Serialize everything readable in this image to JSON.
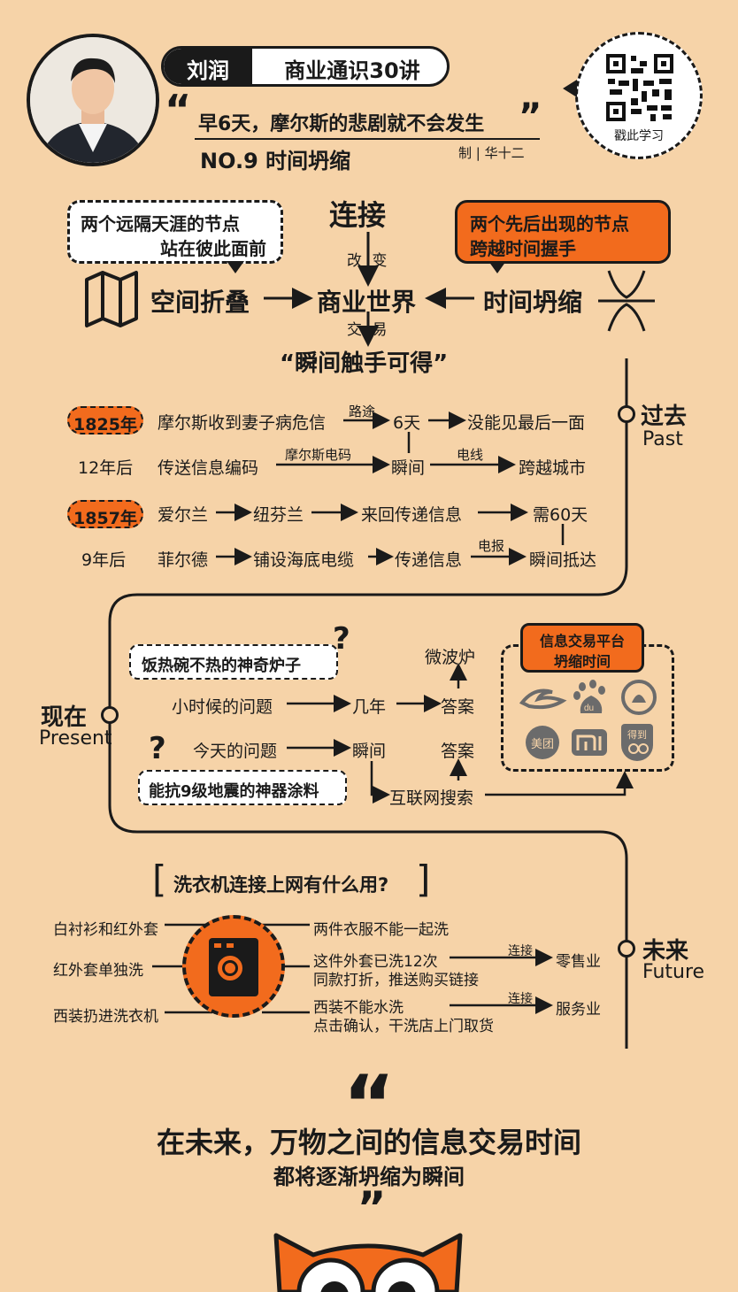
{
  "colors": {
    "background": "#f6d3a8",
    "accent": "#f26b1d",
    "ink": "#1a1a1a"
  },
  "header": {
    "author": "刘润",
    "course": "商业通识30讲",
    "quote": "早6天，摩尔斯的悲剧就不会发生",
    "episode": "NO.9 时间坍缩",
    "credit": "制 | 华十二",
    "qr_label": "戳此学习",
    "portrait_icon": "author-portrait",
    "qr_icon": "qr-code"
  },
  "concept": {
    "bubble_left": [
      "两个远隔天涯的节点",
      "站在彼此面前"
    ],
    "bubble_right": [
      "两个先后出现的节点",
      "跨越时间握手"
    ],
    "top": "连接",
    "change": "改 变",
    "left": "空间折叠",
    "center": "商业世界",
    "right": "时间坍缩",
    "trade": "交 易",
    "bottom": "“瞬间触手可得”",
    "map_icon": "folded-map-icon",
    "converge_icon": "converging-lines-icon"
  },
  "past": {
    "title": "过去",
    "title_en": "Past",
    "row1": {
      "year": "1825年",
      "event": "摩尔斯收到妻子病危信",
      "via": "路途",
      "time": "6天",
      "result": "没能见最后一面"
    },
    "row2": {
      "year": "12年后",
      "event": "传送信息编码",
      "via": "摩尔斯电码",
      "time": "瞬间",
      "via2": "电线",
      "result": "跨越城市"
    },
    "row3": {
      "year": "1857年",
      "from": "爱尔兰",
      "to": "纽芬兰",
      "action": "来回传递信息",
      "result": "需60天"
    },
    "row4": {
      "year": "9年后",
      "who": "菲尔德",
      "action": "铺设海底电缆",
      "what": "传递信息",
      "via": "电报",
      "result": "瞬间抵达"
    }
  },
  "present": {
    "title": "现在",
    "title_en": "Present",
    "q1_bubble": "饭热碗不热的神奇炉子",
    "q2_bubble": "能抗9级地震的神器涂料",
    "child_q": "小时候的问题",
    "today_q": "今天的问题",
    "years": "几年",
    "instant": "瞬间",
    "answer1": "答案",
    "answer2": "答案",
    "microwave": "微波炉",
    "search": "互联网搜索",
    "platform_title": [
      "信息交易平台",
      "坍缩时间"
    ],
    "logos": [
      "alibaba-logo",
      "baidu-logo",
      "zhihu-logo",
      "meituan-logo",
      "xiaomi-logo",
      "dedao-logo"
    ],
    "logo_texts": [
      "美团",
      "得到"
    ]
  },
  "future": {
    "title": "未来",
    "title_en": "Future",
    "question": "洗衣机连接上网有什么用?",
    "left": [
      "白衬衫和红外套",
      "红外套单独洗",
      "西装扔进洗衣机"
    ],
    "right1": "两件衣服不能一起洗",
    "right2": [
      "这件外套已洗12次",
      "同款打折，推送购买链接"
    ],
    "right3": [
      "西装不能水洗",
      "点击确认，干洗店上门取货"
    ],
    "link": "连接",
    "retail": "零售业",
    "service": "服务业",
    "washer_icon": "washing-machine-icon"
  },
  "footer": {
    "open_quote": "“",
    "line1": "在未来，万物之间的信息交易时间",
    "line2": "都将逐渐坍缩为瞬间",
    "close_quote": "”",
    "mascot_icon": "owl-mascot"
  }
}
